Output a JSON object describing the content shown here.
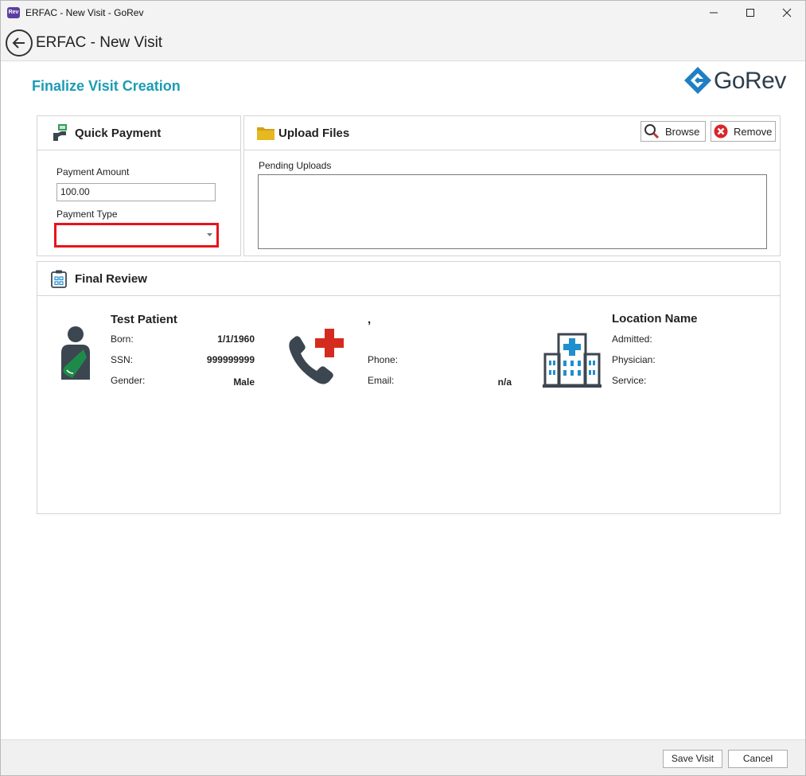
{
  "window": {
    "icon_label": "Rev",
    "title": "ERFAC - New Visit - GoRev",
    "controls": [
      "minimize-icon",
      "maximize-icon",
      "close-icon"
    ]
  },
  "header": {
    "title": "ERFAC - New Visit"
  },
  "page": {
    "title": "Finalize Visit Creation"
  },
  "logo": {
    "text": "GoRev",
    "color": "#1f7fc4"
  },
  "quick_payment": {
    "title": "Quick Payment",
    "amount_label": "Payment Amount",
    "amount_value": "100.00",
    "type_label": "Payment Type",
    "type_value": ""
  },
  "upload_files": {
    "title": "Upload Files",
    "browse_label": "Browse",
    "remove_label": "Remove",
    "pending_label": "Pending Uploads"
  },
  "final_review": {
    "title": "Final Review",
    "patient": {
      "name": "Test Patient",
      "born_label": "Born:",
      "born_value": "1/1/1960",
      "ssn_label": "SSN:",
      "ssn_value": "999999999",
      "gender_label": "Gender:",
      "gender_value": "Male"
    },
    "contact": {
      "name": ",",
      "phone_label": "Phone:",
      "phone_value": "",
      "email_label": "Email:",
      "email_value": "n/a"
    },
    "location": {
      "name": "Location Name",
      "admitted_label": "Admitted:",
      "physician_label": "Physician:",
      "service_label": "Service:"
    }
  },
  "footer": {
    "save_label": "Save Visit",
    "cancel_label": "Cancel"
  },
  "colors": {
    "accent": "#1b9cb5",
    "highlight": "#e8141c",
    "icon_dark": "#3c4650",
    "sling_green": "#1e8a4a",
    "medical_red": "#d52b1e",
    "hospital_blue": "#1f8fcf"
  }
}
